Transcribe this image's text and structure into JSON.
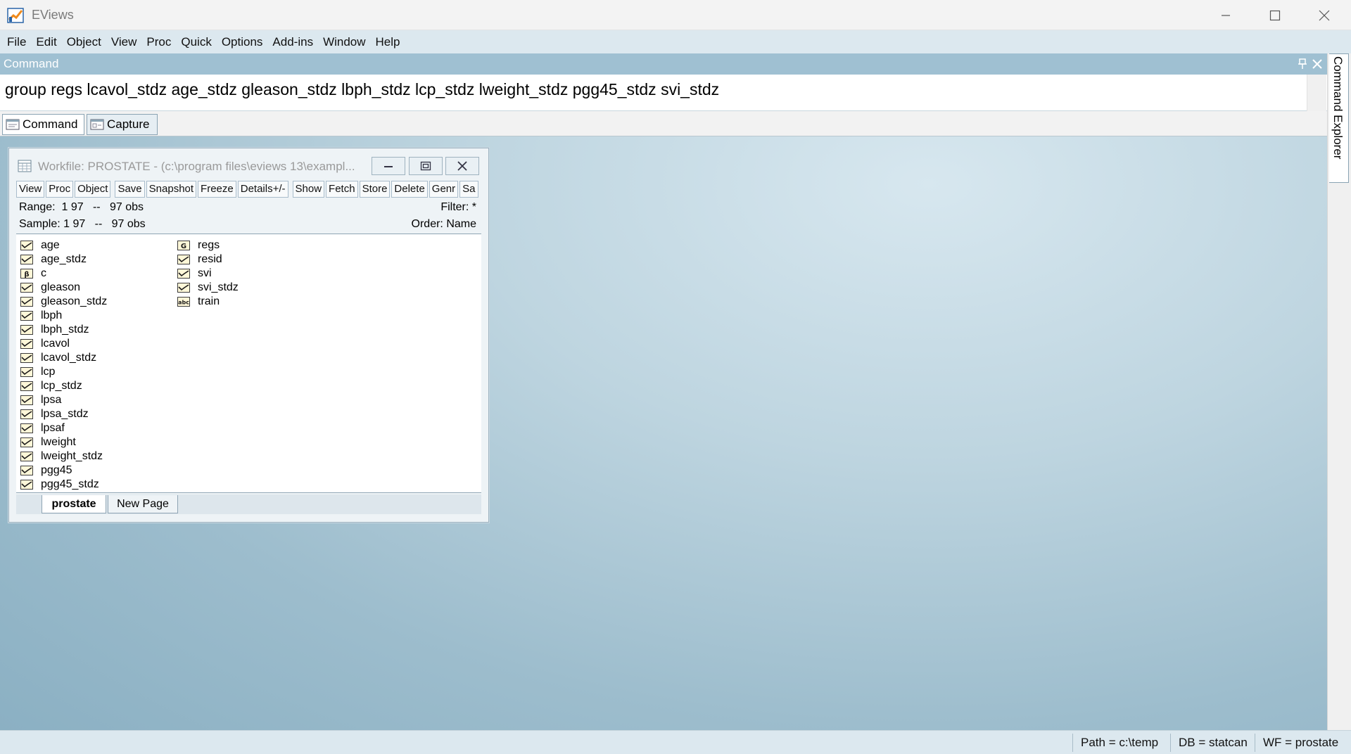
{
  "app": {
    "title": "EViews"
  },
  "menu": [
    "File",
    "Edit",
    "Object",
    "View",
    "Proc",
    "Quick",
    "Options",
    "Add-ins",
    "Window",
    "Help"
  ],
  "command_panel": {
    "title": "Command",
    "text": "group regs lcavol_stdz age_stdz gleason_stdz lbph_stdz lcp_stdz lweight_stdz pgg45_stdz svi_stdz",
    "tabs": [
      "Command",
      "Capture"
    ]
  },
  "side_tab": {
    "label": "Command Explorer"
  },
  "workfile": {
    "title": "Workfile: PROSTATE - (c:\\program files\\eviews 13\\exampl...",
    "toolbar": [
      "View",
      "Proc",
      "Object",
      "Save",
      "Snapshot",
      "Freeze",
      "Details+/-",
      "Show",
      "Fetch",
      "Store",
      "Delete",
      "Genr",
      "Sa"
    ],
    "range": "Range:  1 97   --   97 obs",
    "sample": "Sample: 1 97   --   97 obs",
    "filter": "Filter: *",
    "order": "Order: Name",
    "objects_col1": [
      {
        "name": "age",
        "icon": "series-icon"
      },
      {
        "name": "age_stdz",
        "icon": "series-icon"
      },
      {
        "name": "c",
        "icon": "coef-icon"
      },
      {
        "name": "gleason",
        "icon": "series-icon"
      },
      {
        "name": "gleason_stdz",
        "icon": "series-icon"
      },
      {
        "name": "lbph",
        "icon": "series-icon"
      },
      {
        "name": "lbph_stdz",
        "icon": "series-icon"
      },
      {
        "name": "lcavol",
        "icon": "series-icon"
      },
      {
        "name": "lcavol_stdz",
        "icon": "series-icon"
      },
      {
        "name": "lcp",
        "icon": "series-icon"
      },
      {
        "name": "lcp_stdz",
        "icon": "series-icon"
      },
      {
        "name": "lpsa",
        "icon": "series-icon"
      },
      {
        "name": "lpsa_stdz",
        "icon": "series-icon"
      },
      {
        "name": "lpsaf",
        "icon": "series-icon"
      },
      {
        "name": "lweight",
        "icon": "series-icon"
      },
      {
        "name": "lweight_stdz",
        "icon": "series-icon"
      },
      {
        "name": "pgg45",
        "icon": "series-icon"
      },
      {
        "name": "pgg45_stdz",
        "icon": "series-icon"
      }
    ],
    "objects_col2": [
      {
        "name": "regs",
        "icon": "group-icon"
      },
      {
        "name": "resid",
        "icon": "series-icon"
      },
      {
        "name": "svi",
        "icon": "series-icon"
      },
      {
        "name": "svi_stdz",
        "icon": "series-icon"
      },
      {
        "name": "train",
        "icon": "alpha-icon"
      }
    ],
    "pages": [
      "prostate",
      "New Page"
    ]
  },
  "status": {
    "path": "Path = c:\\temp",
    "db": "DB = statcan",
    "wf": "WF = prostate"
  }
}
